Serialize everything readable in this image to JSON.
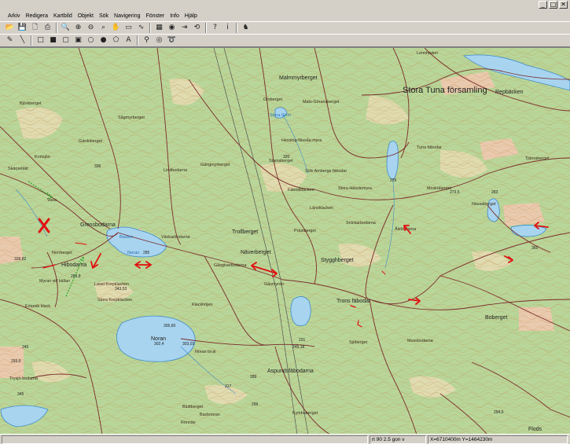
{
  "window": {
    "minimize_glyph": "_",
    "maximize_glyph": "□",
    "close_glyph": "✕"
  },
  "menu": [
    "Arkiv",
    "Redigera",
    "Kartbild",
    "Objekt",
    "Sök",
    "Navigering",
    "Fönster",
    "Info",
    "Hjälp"
  ],
  "toolbar1": [
    {
      "name": "open-icon",
      "glyph": "📂"
    },
    {
      "name": "save-icon",
      "glyph": "💾"
    },
    {
      "name": "print-preview-icon",
      "glyph": "🗋"
    },
    {
      "name": "print-icon",
      "glyph": "⎙"
    },
    {
      "name": "zoom-icon",
      "glyph": "🔍"
    },
    {
      "name": "zoom-in-icon",
      "glyph": "⊕"
    },
    {
      "name": "zoom-out-icon",
      "glyph": "⊖"
    },
    {
      "name": "zoom-area-icon",
      "glyph": "⌕"
    },
    {
      "name": "pan-hand-icon",
      "glyph": "✋"
    },
    {
      "name": "scale-icon",
      "glyph": "▭"
    },
    {
      "name": "measure-icon",
      "glyph": "∿"
    },
    {
      "name": "layers-icon",
      "glyph": "▦"
    },
    {
      "name": "search-map-icon",
      "glyph": "◉"
    },
    {
      "name": "export-icon",
      "glyph": "⇥"
    },
    {
      "name": "rotate-icon",
      "glyph": "⟲"
    },
    {
      "name": "help-icon",
      "glyph": "?"
    },
    {
      "name": "info-icon",
      "glyph": "i"
    },
    {
      "name": "animal-icon",
      "glyph": "♞"
    }
  ],
  "toolbar2": [
    {
      "name": "pencil-icon",
      "glyph": "✎"
    },
    {
      "name": "line-icon",
      "glyph": "╲"
    },
    {
      "name": "rectangle-icon",
      "glyph": "□"
    },
    {
      "name": "filled-rectangle-icon",
      "glyph": "■"
    },
    {
      "name": "rounded-rectangle-icon",
      "glyph": "▢"
    },
    {
      "name": "filled-rounded-rectangle-icon",
      "glyph": "▣"
    },
    {
      "name": "ellipse-icon",
      "glyph": "○"
    },
    {
      "name": "filled-ellipse-icon",
      "glyph": "●"
    },
    {
      "name": "polygon-icon",
      "glyph": "⬠"
    },
    {
      "name": "text-tool-icon",
      "glyph": "A"
    },
    {
      "name": "pipette-icon",
      "glyph": "⚲"
    },
    {
      "name": "eye-icon",
      "glyph": "◎"
    },
    {
      "name": "lasso-icon",
      "glyph": "➰"
    }
  ],
  "map": {
    "place_labels": [
      "Malmmyrberget",
      "Orsberget",
      "Stora Tuna församling",
      "Repbäcken",
      "Lennheden",
      "Stora Grim",
      "Mats-Göransberget",
      "Björkberget",
      "Grensbodarna",
      "Väckarbodarna",
      "Trollberget",
      "Näverberget",
      "Gåsgivarbodarna",
      "Gåsmyran",
      "Trons fäbodar",
      "Stygghberget",
      "Boberget",
      "Noran",
      "Noran bruk",
      "Aspundsfäbodarna",
      "Kyrkboberget",
      "Mossbodarna",
      "Sjöberget",
      "Länsklacken",
      "Mosköberget",
      "Tjärnaberget",
      "Ålsbodarna",
      "Fäbodklacken",
      "Norrberget",
      "Hibodarna",
      "Lasel Korpklacken",
      "Stora Korpklacken",
      "Klackhöjen",
      "Myran vid källan",
      "Erlands klack",
      "Trysjö-bodarna",
      "Bluttberget",
      "Backnoran",
      "Rönnäs",
      "Flods",
      "Gärdsberget",
      "Sågmyrberget",
      "Skärpetäkt",
      "Vasa",
      "Stamsberget",
      "Snickarbodarna",
      "Prästberget",
      "Nässaberget",
      "Sölv Amberge fäbodar",
      "Kortsjön",
      "Tuna fäbodar",
      "Hessing-Nissåa myra",
      "Lindbodarna",
      "Gängmyrberget",
      "Stora Hässlemyra"
    ],
    "water_labels": [
      "Noran",
      "Basten"
    ],
    "elevations": [
      "320",
      "336",
      "285",
      "302,4",
      "303,03",
      "305,60",
      "231",
      "229",
      "283",
      "339,82",
      "343,53",
      "245",
      "345",
      "299",
      "317",
      "289",
      "293,0",
      "294,6",
      "355",
      "289,8",
      "273,5",
      "245,18"
    ]
  },
  "status": {
    "empty": "",
    "scale": "rt 90 2.5 gon v",
    "coords": "X=6710400m Y=1464230m"
  }
}
